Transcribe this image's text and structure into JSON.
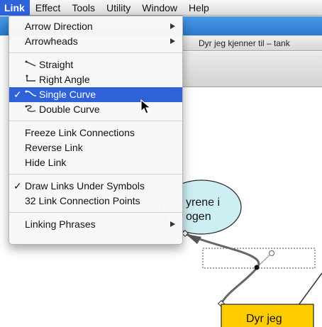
{
  "menubar": {
    "items": [
      "Link",
      "Effect",
      "Tools",
      "Utility",
      "Window",
      "Help"
    ]
  },
  "document": {
    "title": "Dyr jeg kjenner til – tank"
  },
  "link_menu": {
    "group1": [
      {
        "label": "Arrow Direction",
        "submenu": true
      },
      {
        "label": "Arrowheads",
        "submenu": true
      }
    ],
    "group2": [
      {
        "label": "Straight",
        "icon": "straight-line-icon",
        "checked": false
      },
      {
        "label": "Right Angle",
        "icon": "right-angle-icon",
        "checked": false
      },
      {
        "label": "Single Curve",
        "icon": "single-curve-icon",
        "checked": true,
        "highlighted": true
      },
      {
        "label": "Double Curve",
        "icon": "double-curve-icon",
        "checked": false
      }
    ],
    "group3": [
      {
        "label": "Freeze Link Connections"
      },
      {
        "label": "Reverse Link"
      },
      {
        "label": "Hide Link"
      }
    ],
    "group4": [
      {
        "label": "Draw Links Under Symbols",
        "checked": true
      },
      {
        "label": "32 Link Connection Points",
        "checked": false
      }
    ],
    "group5": [
      {
        "label": "Linking Phrases",
        "submenu": true
      }
    ],
    "checkmark": "✓"
  },
  "diagram": {
    "oval_line1": "yrene i",
    "oval_line2": "ogen",
    "box_label": "Dyr jeg",
    "oval_color": "#cdeef3",
    "box_color": "#ffcc00"
  },
  "colors": {
    "menu_highlight": "#2f62d6",
    "menubar_active": "#2f63d8",
    "toolbar_blue": "#2c78d0"
  }
}
